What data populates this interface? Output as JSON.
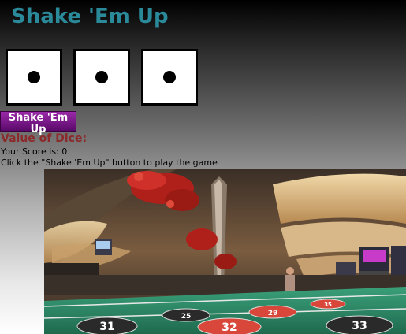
{
  "page": {
    "title": "Shake 'Em Up",
    "shake_button_label": "Shake 'Em Up",
    "value_of_dice_label": "Value of Dice:",
    "score_text": "Your Score is: 0",
    "instruction_text": "Click the \"Shake 'Em Up\" button to play the game"
  },
  "dice": [
    {
      "value": 1
    },
    {
      "value": 1
    },
    {
      "value": 1
    }
  ],
  "casino_image": {
    "roulette_numbers": [
      "31",
      "32",
      "33",
      "25",
      "29",
      "35"
    ],
    "colors": {
      "felt": "#2f8a66",
      "red": "#d9473a",
      "ceiling_gold": "#d9b682",
      "floral_red": "#b0201a"
    }
  },
  "colors": {
    "title": "#2a8a9a",
    "button": "#7a1a88",
    "value_label": "#8a2a2a"
  }
}
